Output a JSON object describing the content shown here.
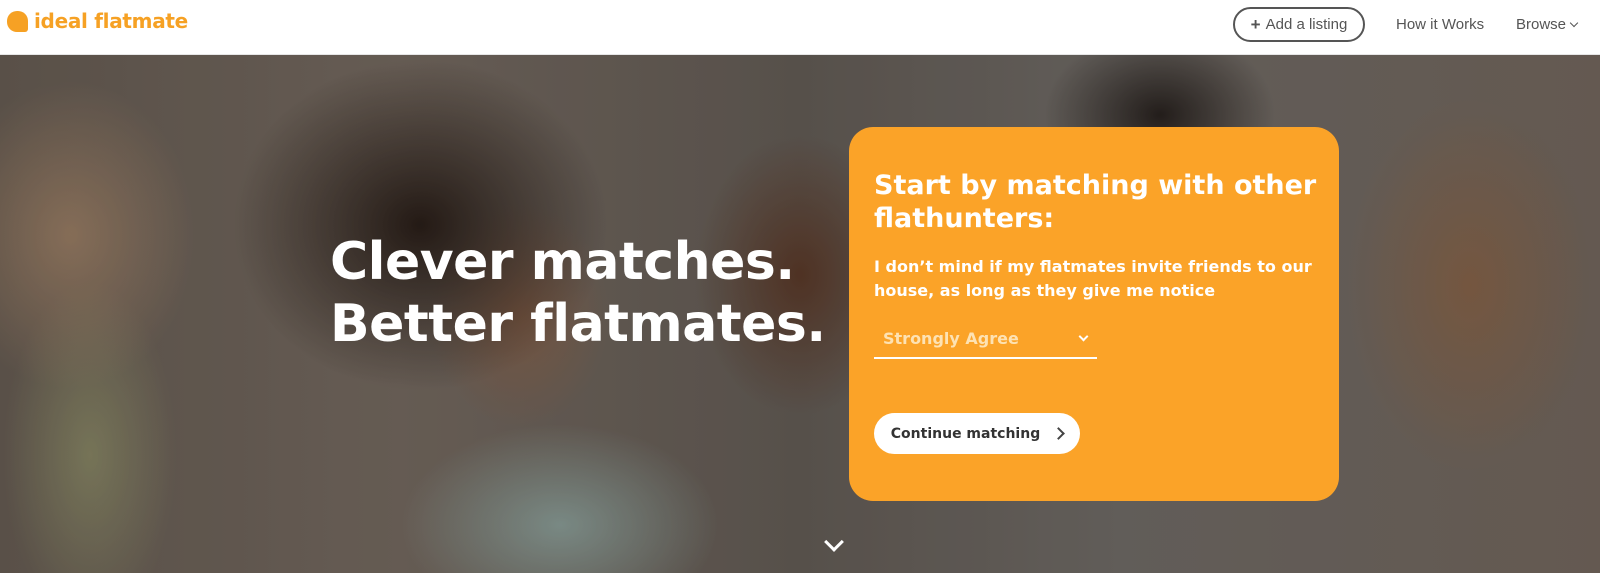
{
  "brand": {
    "name": "ideal flatmate",
    "color": "#f6a124"
  },
  "header": {
    "add_listing_icon": "plus-icon",
    "add_listing_label": "Add a listing",
    "how_it_works_label": "How it Works",
    "browse_label": "Browse"
  },
  "hero": {
    "headline_line1": "Clever matches.",
    "headline_line2": "Better flatmates."
  },
  "match_card": {
    "background_color": "#fba328",
    "title": "Start by matching with other flathunters:",
    "question": "I don’t mind if my flatmates invite friends to our house, as long as they give me notice",
    "answer_selected": "Strongly Agree",
    "continue_label": "Continue matching"
  }
}
